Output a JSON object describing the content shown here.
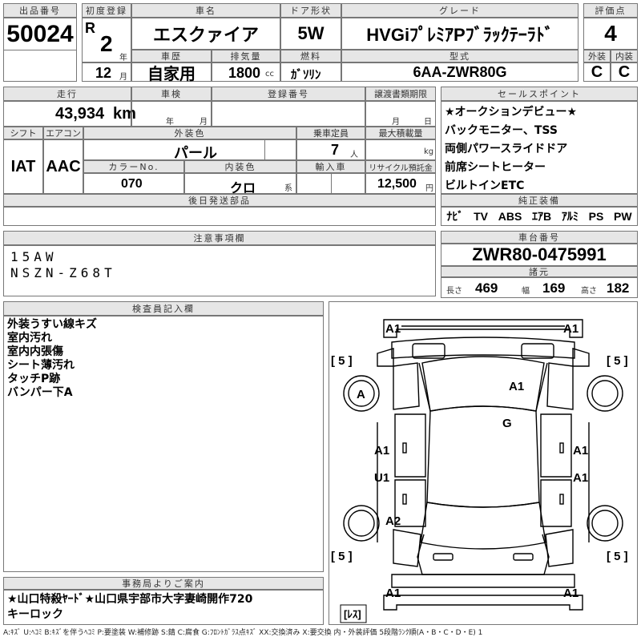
{
  "header": {
    "lot_label": "出品番号",
    "lot_number": "50024",
    "first_reg_label": "初度登録",
    "era": "R",
    "year": "2",
    "year_unit": "年",
    "month": "12",
    "month_unit": "月",
    "car_name_label": "車名",
    "car_name": "エスクァイア",
    "door_label": "ドア形状",
    "door": "5W",
    "grade_label": "グレード",
    "grade": "HVGiﾌﾟﾚﾐｱPﾌﾞﾗｯｸﾃｰﾗﾄﾞ",
    "score_label": "評価点",
    "score": "4",
    "history_label": "車歴",
    "history": "自家用",
    "displacement_label": "排気量",
    "displacement": "1800",
    "displacement_unit": "cc",
    "fuel_label": "燃料",
    "fuel": "ｶﾞｿﾘﾝ",
    "model_label": "型式",
    "model": "6AA-ZWR80G",
    "exterior_label": "外装",
    "exterior_grade": "C",
    "interior_label": "内装",
    "interior_grade": "C"
  },
  "specs": {
    "mileage_label": "走行",
    "mileage": "43,934",
    "mileage_unit": "km",
    "inspection_label": "車検",
    "inspection_year_unit": "年",
    "inspection_month_unit": "月",
    "reg_no_label": "登録番号",
    "transfer_label": "譲渡書類期限",
    "transfer_month_unit": "月",
    "transfer_day_unit": "日",
    "shift_label": "シフト",
    "shift": "IAT",
    "ac_label": "エアコン",
    "ac": "AAC",
    "ext_color_label": "外装色",
    "ext_color": "パール",
    "capacity_label": "乗車定員",
    "capacity": "7",
    "capacity_unit": "人",
    "max_load_label": "最大積載量",
    "max_load_unit": "kg",
    "color_no_label": "カラーNo.",
    "color_no": "070",
    "int_color_label": "内装色",
    "int_color": "クロ",
    "int_color_unit": "系",
    "import_label": "輸入車",
    "recycle_label": "リサイクル預託金",
    "recycle": "12,500",
    "recycle_unit": "円",
    "later_parts_label": "後日発送部品"
  },
  "sales_points": {
    "label": "セールスポイント",
    "items": [
      "★オークションデビュー★",
      "バックモニター、TSS",
      "両側パワースライドドア",
      "前席シートヒーター",
      "ビルトインETC"
    ]
  },
  "equipment": {
    "label": "純正装備",
    "items": [
      "ﾅﾋﾞ",
      "TV",
      "ABS",
      "ｴｱB",
      "ｱﾙﾐ",
      "PS",
      "PW"
    ]
  },
  "notes": {
    "label": "注意事項欄",
    "lines": [
      "15AW",
      "NSZN-Z68T"
    ]
  },
  "chassis": {
    "label": "車台番号",
    "number": "ZWR80-0475991",
    "dims_label": "諸元",
    "length_label": "長さ",
    "length": "469",
    "width_label": "幅",
    "width": "169",
    "height_label": "高さ",
    "height": "182"
  },
  "inspector": {
    "label": "検査員記入欄",
    "lines": [
      "外装うすい線キズ",
      "室内汚れ",
      "室内内張傷",
      "シート薄汚れ",
      "タッチP跡",
      "バンパー下A"
    ]
  },
  "diagram": {
    "marks": [
      "A1",
      "A1",
      "A1",
      "G",
      "A",
      "A1",
      "A1",
      "U1",
      "A1",
      "A2",
      "A1",
      "A1"
    ],
    "tires": [
      "[ 5 ]",
      "[ 5 ]",
      "[ 5 ]",
      "[ 5 ]"
    ],
    "spare": "[ﾚｽ]"
  },
  "office": {
    "label": "事務局よりご案内",
    "lines": [
      "★山口特殺ﾔｰﾄﾞ★山口県宇部市大字妻崎開作720",
      "キーロック"
    ]
  },
  "legend": "A:ｷｽﾞ U:ﾍｺﾐ B:ｷｽﾞを伴うﾍｺﾐ P:要塗装 W:補修跡 S:錆 C:腐食 G:ﾌﾛﾝﾄｶﾞﾗｽ点ｷｽﾞ XX:交換済み X:要交換 内・外装評価 5段階ﾗﾝｸ順(A・B・C・D・E) 1"
}
